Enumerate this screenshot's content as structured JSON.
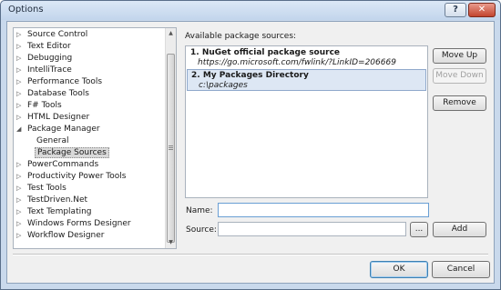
{
  "window": {
    "title": "Options",
    "help_label": "?",
    "close_label": "✕"
  },
  "tree": {
    "items": [
      {
        "label": "Source Control",
        "expander": "▷"
      },
      {
        "label": "Text Editor",
        "expander": "▷"
      },
      {
        "label": "Debugging",
        "expander": "▷"
      },
      {
        "label": "IntelliTrace",
        "expander": "▷"
      },
      {
        "label": "Performance Tools",
        "expander": "▷"
      },
      {
        "label": "Database Tools",
        "expander": "▷"
      },
      {
        "label": "F# Tools",
        "expander": "▷"
      },
      {
        "label": "HTML Designer",
        "expander": "▷"
      },
      {
        "label": "Package Manager",
        "expander": "◢"
      },
      {
        "label": "General",
        "expander": ""
      },
      {
        "label": "Package Sources",
        "expander": ""
      },
      {
        "label": "PowerCommands",
        "expander": "▷"
      },
      {
        "label": "Productivity Power Tools",
        "expander": "▷"
      },
      {
        "label": "Test Tools",
        "expander": "▷"
      },
      {
        "label": "TestDriven.Net",
        "expander": "▷"
      },
      {
        "label": "Text Templating",
        "expander": "▷"
      },
      {
        "label": "Windows Forms Designer",
        "expander": "▷"
      },
      {
        "label": "Workflow Designer",
        "expander": "▷"
      }
    ],
    "scroll_up": "▲",
    "scroll_down": "▼"
  },
  "sources": {
    "label": "Available package sources:",
    "items": [
      {
        "name": "1. NuGet official package source",
        "url": "https://go.microsoft.com/fwlink/?LinkID=206669"
      },
      {
        "name": "2. My Packages Directory",
        "url": "c:\\packages"
      }
    ]
  },
  "buttons": {
    "move_up": "Move Up",
    "move_down": "Move Down",
    "remove": "Remove",
    "browse": "...",
    "add": "Add",
    "ok": "OK",
    "cancel": "Cancel"
  },
  "fields": {
    "name_label": "Name:",
    "name_value": "",
    "source_label": "Source:",
    "source_value": ""
  }
}
